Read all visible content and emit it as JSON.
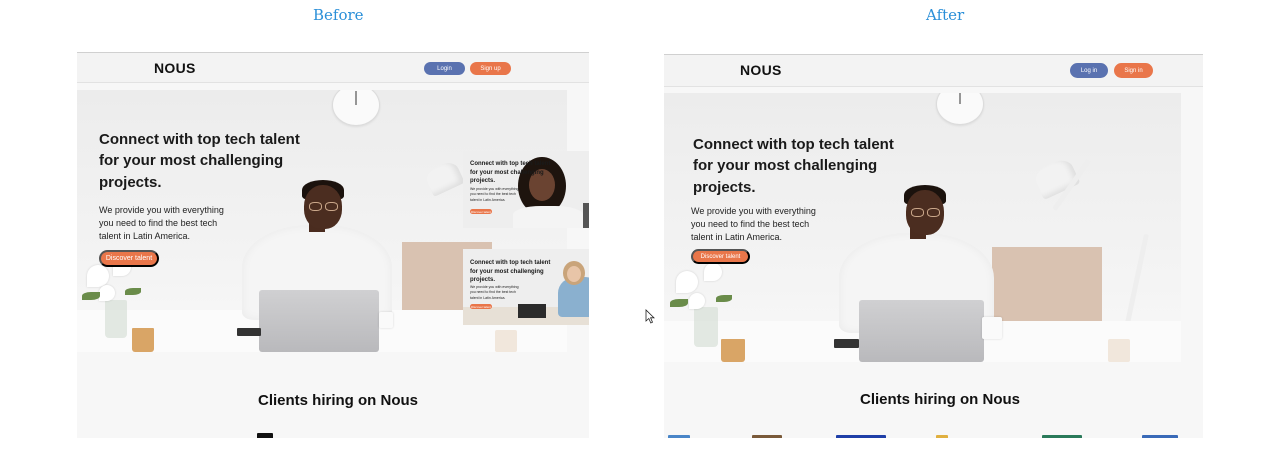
{
  "captions": {
    "before": "Before",
    "after": "After"
  },
  "before": {
    "nav": {
      "logo": "NOUS",
      "login": "Login",
      "signup": "Sign up"
    },
    "hero": {
      "title_lines": [
        "Connect with top tech talent",
        "for your most challenging",
        "projects."
      ],
      "desc_lines": [
        "We provide you with everything",
        "you need to find the best tech",
        "talent in Latin America."
      ],
      "cta": "Discover talent"
    },
    "cards": [
      {
        "title_lines": [
          "Connect with top tech talent",
          "for your most challenging",
          "projects."
        ],
        "desc_lines": [
          "We provide you with everything",
          "you need to find the best tech",
          "talent in Latin America."
        ],
        "cta": "Discover talent"
      },
      {
        "title_lines": [
          "Connect with top tech talent",
          "for your most challenging",
          "projects."
        ],
        "desc_lines": [
          "We provide you with everything",
          "you need to find the best tech",
          "talent in Latin America."
        ],
        "cta": "Discover talent"
      }
    ],
    "clients_title": "Clients hiring on Nous"
  },
  "after": {
    "nav": {
      "logo": "NOUS",
      "login": "Log in",
      "signup": "Sign in"
    },
    "hero": {
      "title_lines": [
        "Connect with top tech talent",
        "for your most challenging",
        "projects."
      ],
      "desc_lines": [
        "We provide you with everything",
        "you need to find the best tech",
        "talent in Latin America."
      ],
      "cta": "Discover talent"
    },
    "clients_title": "Clients hiring on Nous"
  },
  "colors": {
    "caption": "#2a8fd8",
    "login_button": "#5a72b0",
    "signup_button": "#e9764a",
    "cta": "#e9764a"
  },
  "icons": {
    "cursor": "mouse-pointer-icon"
  }
}
